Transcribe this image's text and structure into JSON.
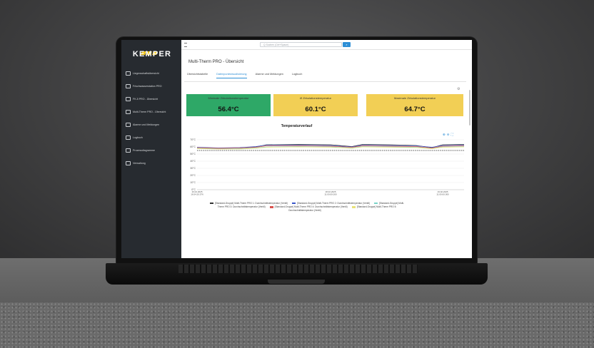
{
  "brand": {
    "name": "KEMPER",
    "accent": "#f0c419"
  },
  "sidebar": {
    "items": [
      {
        "label": "Liegenschaftsübersicht",
        "icon": "building-icon"
      },
      {
        "label": "Frischwasserstation PRO",
        "icon": "station-icon"
      },
      {
        "label": "FK-5 PRO - Übersicht",
        "icon": "device-icon"
      },
      {
        "label": "Multi-Therm PRO - Übersicht",
        "icon": "device-icon"
      },
      {
        "label": "Alarme und Meldungen",
        "icon": "alarm-icon"
      },
      {
        "label": "Logbuch",
        "icon": "logbook-icon"
      },
      {
        "label": "Prozessdiagramme",
        "icon": "diagram-icon"
      },
      {
        "label": "Verwaltung",
        "icon": "settings-icon"
      }
    ]
  },
  "topbar": {
    "search_placeholder": "Q Suchen (Ctrl+Space)",
    "search_button": "⌕"
  },
  "page": {
    "title": "Multi-Therm PRO - Übersicht"
  },
  "tabs": [
    {
      "label": "Übersichtstabelle",
      "active": false
    },
    {
      "label": "Datenpunktvisualisierung",
      "active": true
    },
    {
      "label": "Alarme und Meldungen",
      "active": false
    },
    {
      "label": "Logbuch",
      "active": false
    }
  ],
  "kpis": [
    {
      "label": "Minimale Zirkulationstemperatur",
      "value": "56.4°C",
      "color": "#2ea867"
    },
    {
      "label": "Ø Zirkulationstemperatur",
      "value": "60.1°C",
      "color": "#f2cf55"
    },
    {
      "label": "Maximale Zirkulationstemperatur",
      "value": "64.7°C",
      "color": "#f2cf55"
    }
  ],
  "chart_data": {
    "type": "line",
    "title": "Temperaturverlauf",
    "y_ticks": [
      "70°C",
      "60°C",
      "50°C",
      "40°C",
      "30°C",
      "20°C",
      "10°C",
      "0°C"
    ],
    "ylim": [
      0,
      70
    ],
    "x_ticks": [
      {
        "line1": "16.02.2025",
        "line2": "16:54:20.576"
      },
      {
        "line1": "18.02.2025",
        "line2": "11:00:00.000"
      },
      {
        "line1": "19.02.2025",
        "line2": "11:00:00.000"
      }
    ],
    "xlim": [
      0,
      100
    ],
    "series": [
      {
        "name": "[Standard-Gruppe] Multi-Therm PRO 1: Durchschnittstemperatur (Ventil)",
        "color": "#333333",
        "x": [
          0,
          8,
          16,
          22,
          26,
          38,
          50,
          58,
          62,
          72,
          82,
          88,
          92,
          100
        ],
        "values": [
          59,
          58,
          58.5,
          60,
          63,
          63.5,
          63,
          60.5,
          63.5,
          63,
          62,
          59,
          63,
          63.5
        ]
      },
      {
        "name": "[Standard-Gruppe] Multi-Therm PRO 2: Durchschnittstemperatur (Ventil)",
        "color": "#3a56c9",
        "x": [
          0,
          8,
          16,
          22,
          26,
          38,
          50,
          58,
          62,
          72,
          82,
          88,
          92,
          100
        ],
        "values": [
          59.5,
          58.5,
          59,
          60.5,
          62.5,
          62.5,
          62,
          60,
          62.5,
          62,
          61.5,
          59.5,
          62,
          62.5
        ]
      },
      {
        "name": "[Standard-Gruppe] Multi-Therm PRO 3: Durchschnittstemperatur (Ventil)",
        "color": "#7ad3c8",
        "x": [
          0,
          8,
          16,
          22,
          26,
          38,
          50,
          58,
          62,
          72,
          82,
          88,
          92,
          100
        ],
        "values": [
          58,
          57.5,
          57.5,
          58.5,
          60,
          60.5,
          60,
          58.5,
          60.5,
          60,
          59.5,
          58,
          60,
          60.5
        ]
      },
      {
        "name": "[Standard-Gruppe] Multi-Therm PRO 4: Durchschnittstemperatur (Ventil)",
        "color": "#d9534f",
        "x": [
          0,
          8,
          16,
          22,
          26,
          38,
          50,
          58,
          62,
          72,
          82,
          88,
          92,
          100
        ],
        "values": [
          59,
          58,
          58.5,
          59.5,
          61.5,
          61.5,
          61,
          59.5,
          61.5,
          61,
          60.5,
          58.5,
          61,
          61.5
        ]
      },
      {
        "name": "[Standard-Gruppe] Multi-Therm PRO 5: Durchschnittstemperatur (Ventil)",
        "color": "#e8e27a",
        "x": [
          0,
          8,
          16,
          22,
          26,
          38,
          50,
          58,
          62,
          72,
          82,
          88,
          92,
          100
        ],
        "values": [
          57.5,
          57,
          57,
          58,
          59.5,
          60,
          59.5,
          58,
          60,
          59.5,
          59,
          57.5,
          59.5,
          60
        ]
      },
      {
        "name": "",
        "color": "#555555",
        "dashed": true,
        "x": [
          0,
          100
        ],
        "values": [
          55,
          55
        ]
      }
    ]
  }
}
